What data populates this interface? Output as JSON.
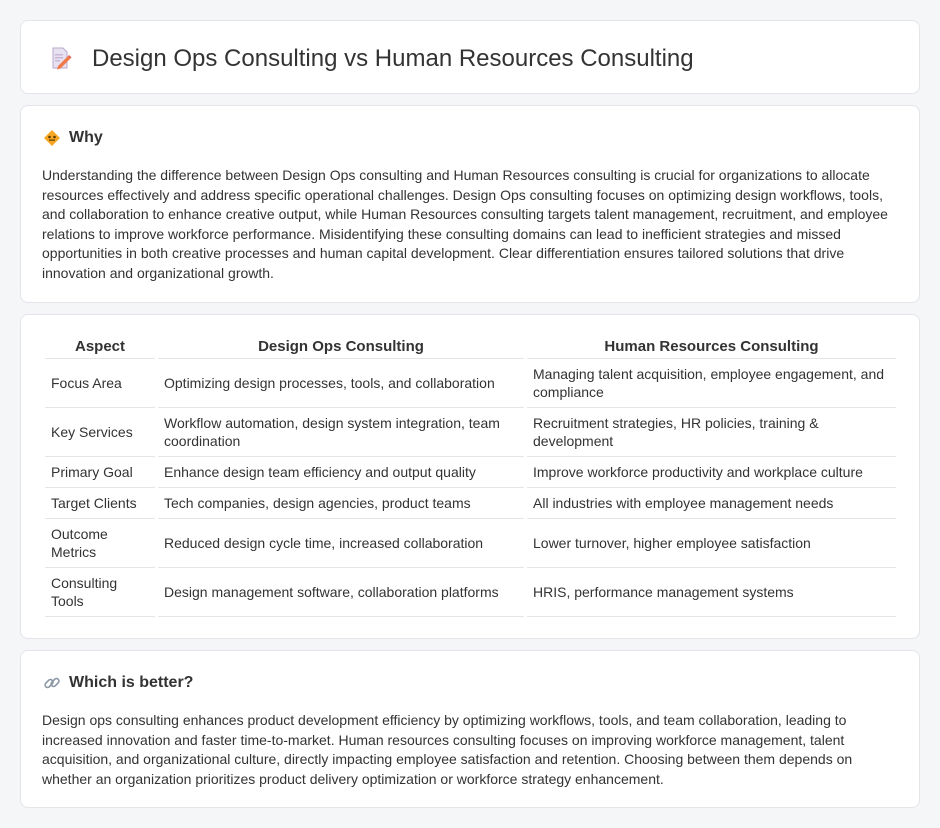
{
  "header": {
    "title": "Design Ops Consulting vs Human Resources Consulting",
    "icon": "document-pencil-icon"
  },
  "why": {
    "heading": "Why",
    "icon": "diamond-sign-icon",
    "text": "Understanding the difference between Design Ops consulting and Human Resources consulting is crucial for organizations to allocate resources effectively and address specific operational challenges. Design Ops consulting focuses on optimizing design workflows, tools, and collaboration to enhance creative output, while Human Resources consulting targets talent management, recruitment, and employee relations to improve workforce performance. Misidentifying these consulting domains can lead to inefficient strategies and missed opportunities in both creative processes and human capital development. Clear differentiation ensures tailored solutions that drive innovation and organizational growth."
  },
  "table": {
    "headers": [
      "Aspect",
      "Design Ops Consulting",
      "Human Resources Consulting"
    ],
    "rows": [
      {
        "aspect": "Focus Area",
        "ops": "Optimizing design processes, tools, and collaboration",
        "hr": "Managing talent acquisition, employee engagement, and compliance"
      },
      {
        "aspect": "Key Services",
        "ops": "Workflow automation, design system integration, team coordination",
        "hr": "Recruitment strategies, HR policies, training & development"
      },
      {
        "aspect": "Primary Goal",
        "ops": "Enhance design team efficiency and output quality",
        "hr": "Improve workforce productivity and workplace culture"
      },
      {
        "aspect": "Target Clients",
        "ops": "Tech companies, design agencies, product teams",
        "hr": "All industries with employee management needs"
      },
      {
        "aspect": "Outcome Metrics",
        "ops": "Reduced design cycle time, increased collaboration",
        "hr": "Lower turnover, higher employee satisfaction"
      },
      {
        "aspect": "Consulting Tools",
        "ops": "Design management software, collaboration platforms",
        "hr": "HRIS, performance management systems"
      }
    ]
  },
  "better": {
    "heading": "Which is better?",
    "icon": "link-icon",
    "text": "Design ops consulting enhances product development efficiency by optimizing workflows, tools, and team collaboration, leading to increased innovation and faster time-to-market. Human resources consulting focuses on improving workforce management, talent acquisition, and organizational culture, directly impacting employee satisfaction and retention. Choosing between them depends on whether an organization prioritizes product delivery optimization or workforce strategy enhancement."
  }
}
